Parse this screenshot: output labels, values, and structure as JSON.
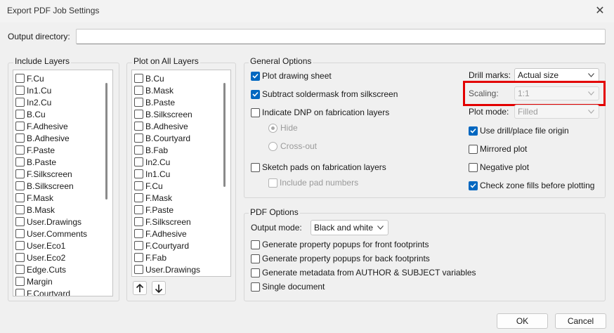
{
  "window": {
    "title": "Export PDF Job Settings",
    "close_glyph": "✕"
  },
  "output_directory": {
    "label": "Output directory:",
    "value": ""
  },
  "include_layers": {
    "title": "Include Layers",
    "items": [
      {
        "label": "F.Cu",
        "checked": false
      },
      {
        "label": "In1.Cu",
        "checked": false
      },
      {
        "label": "In2.Cu",
        "checked": false
      },
      {
        "label": "B.Cu",
        "checked": false
      },
      {
        "label": "F.Adhesive",
        "checked": false
      },
      {
        "label": "B.Adhesive",
        "checked": false
      },
      {
        "label": "F.Paste",
        "checked": false
      },
      {
        "label": "B.Paste",
        "checked": false
      },
      {
        "label": "F.Silkscreen",
        "checked": false
      },
      {
        "label": "B.Silkscreen",
        "checked": false
      },
      {
        "label": "F.Mask",
        "checked": false
      },
      {
        "label": "B.Mask",
        "checked": false
      },
      {
        "label": "User.Drawings",
        "checked": false
      },
      {
        "label": "User.Comments",
        "checked": false
      },
      {
        "label": "User.Eco1",
        "checked": false
      },
      {
        "label": "User.Eco2",
        "checked": false
      },
      {
        "label": "Edge.Cuts",
        "checked": false
      },
      {
        "label": "Margin",
        "checked": false
      },
      {
        "label": "F.Courtyard",
        "checked": false
      }
    ]
  },
  "plot_on_all_layers": {
    "title": "Plot on All Layers",
    "items": [
      {
        "label": "B.Cu",
        "checked": false
      },
      {
        "label": "B.Mask",
        "checked": false
      },
      {
        "label": "B.Paste",
        "checked": false
      },
      {
        "label": "B.Silkscreen",
        "checked": false
      },
      {
        "label": "B.Adhesive",
        "checked": false
      },
      {
        "label": "B.Courtyard",
        "checked": false
      },
      {
        "label": "B.Fab",
        "checked": false
      },
      {
        "label": "In2.Cu",
        "checked": false
      },
      {
        "label": "In1.Cu",
        "checked": false
      },
      {
        "label": "F.Cu",
        "checked": false
      },
      {
        "label": "F.Mask",
        "checked": false
      },
      {
        "label": "F.Paste",
        "checked": false
      },
      {
        "label": "F.Silkscreen",
        "checked": false
      },
      {
        "label": "F.Adhesive",
        "checked": false
      },
      {
        "label": "F.Courtyard",
        "checked": false
      },
      {
        "label": "F.Fab",
        "checked": false
      },
      {
        "label": "User.Drawings",
        "checked": false
      }
    ],
    "move_up_icon": "arrow-up-icon",
    "move_down_icon": "arrow-down-icon"
  },
  "general_options": {
    "title": "General Options",
    "plot_drawing_sheet": {
      "label": "Plot drawing sheet",
      "checked": true
    },
    "subtract_soldermask": {
      "label": "Subtract soldermask from silkscreen",
      "checked": true
    },
    "indicate_dnp": {
      "label": "Indicate DNP on fabrication layers",
      "checked": false
    },
    "dnp_hide": {
      "label": "Hide",
      "checked": true,
      "enabled": false
    },
    "dnp_crossout": {
      "label": "Cross-out",
      "checked": false,
      "enabled": false
    },
    "sketch_pads": {
      "label": "Sketch pads on fabrication layers",
      "checked": false
    },
    "include_pad_numbers": {
      "label": "Include pad numbers",
      "checked": false,
      "enabled": false
    },
    "drill_marks": {
      "label": "Drill marks:",
      "value": "Actual size"
    },
    "scaling": {
      "label": "Scaling:",
      "value": "1:1",
      "enabled": false
    },
    "plot_mode": {
      "label": "Plot mode:",
      "value": "Filled",
      "enabled": false
    },
    "use_drill_origin": {
      "label": "Use drill/place file origin",
      "checked": true
    },
    "mirrored_plot": {
      "label": "Mirrored plot",
      "checked": false
    },
    "negative_plot": {
      "label": "Negative plot",
      "checked": false
    },
    "check_zone_fills": {
      "label": "Check zone fills before plotting",
      "checked": true
    }
  },
  "pdf_options": {
    "title": "PDF Options",
    "output_mode": {
      "label": "Output mode:",
      "value": "Black and white"
    },
    "front_popups": {
      "label": "Generate property popups for front footprints",
      "checked": false
    },
    "back_popups": {
      "label": "Generate property popups for back footprints",
      "checked": false
    },
    "metadata": {
      "label": "Generate metadata from AUTHOR & SUBJECT variables",
      "checked": false
    },
    "single_document": {
      "label": "Single document",
      "checked": false
    }
  },
  "buttons": {
    "ok": "OK",
    "cancel": "Cancel"
  },
  "colors": {
    "accent": "#0067c0",
    "highlight": "#e30000"
  }
}
